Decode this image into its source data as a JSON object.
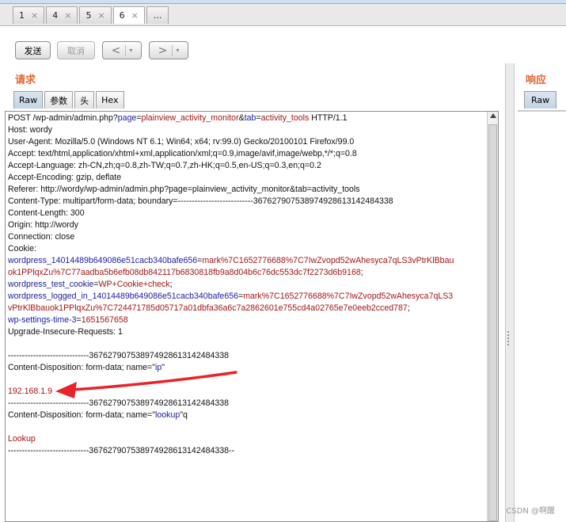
{
  "tabs": [
    {
      "label": "1",
      "close": "×"
    },
    {
      "label": "4",
      "close": "×"
    },
    {
      "label": "5",
      "close": "×"
    },
    {
      "label": "6",
      "close": "×"
    }
  ],
  "tabs_more": "...",
  "toolbar": {
    "send": "发送",
    "cancel": "取消",
    "back": "<",
    "forward": ">",
    "dropdown": "▾"
  },
  "request": {
    "heading": "请求",
    "tabs": [
      "Raw",
      "参数",
      "头",
      "Hex"
    ],
    "lines": [
      [
        {
          "t": "POST /wp-admin/admin.php?",
          "c": "blk"
        },
        {
          "t": "page",
          "c": "blu"
        },
        {
          "t": "=",
          "c": "blk"
        },
        {
          "t": "plainview_activity_monitor",
          "c": "red"
        },
        {
          "t": "&",
          "c": "blk"
        },
        {
          "t": "tab",
          "c": "blu"
        },
        {
          "t": "=",
          "c": "blk"
        },
        {
          "t": "activity_tools",
          "c": "red"
        },
        {
          "t": " HTTP/1.1",
          "c": "blk"
        }
      ],
      [
        {
          "t": "Host: wordy",
          "c": "blk"
        }
      ],
      [
        {
          "t": "User-Agent: Mozilla/5.0 (Windows NT 6.1; Win64; x64; rv:99.0) Gecko/20100101 Firefox/99.0",
          "c": "blk"
        }
      ],
      [
        {
          "t": "Accept: text/html,application/xhtml+xml,application/xml;q=0.9,image/avif,image/webp,*/*;q=0.8",
          "c": "blk"
        }
      ],
      [
        {
          "t": "Accept-Language: zh-CN,zh;q=0.8,zh-TW;q=0.7,zh-HK;q=0.5,en-US;q=0.3,en;q=0.2",
          "c": "blk"
        }
      ],
      [
        {
          "t": "Accept-Encoding: gzip, deflate",
          "c": "blk"
        }
      ],
      [
        {
          "t": "Referer: http://wordy/wp-admin/admin.php?page=plainview_activity_monitor&tab=activity_tools",
          "c": "blk"
        }
      ],
      [
        {
          "t": "Content-Type: multipart/form-data; boundary=---------------------------367627907538974928613142484338",
          "c": "blk"
        }
      ],
      [
        {
          "t": "Content-Length: 300",
          "c": "blk"
        }
      ],
      [
        {
          "t": "Origin: http://wordy",
          "c": "blk"
        }
      ],
      [
        {
          "t": "Connection: close",
          "c": "blk"
        }
      ],
      [
        {
          "t": "Cookie:",
          "c": "blk"
        }
      ],
      [
        {
          "t": "wordpress_14014489b649086e51cacb340bafe656",
          "c": "blu"
        },
        {
          "t": "=",
          "c": "blk"
        },
        {
          "t": "mark%7C1652776688%7C7IwZvopd52wAhesyca7qLS3vPtrKlBbau",
          "c": "red"
        }
      ],
      [
        {
          "t": "ok1PPlqxZu%7C77aadba5b6efb08db842117b6830818fb9a8d04b6c76dc553dc7f2273d6b9168",
          "c": "red"
        },
        {
          "t": ";",
          "c": "blk"
        }
      ],
      [
        {
          "t": "wordpress_test_cookie",
          "c": "blu"
        },
        {
          "t": "=",
          "c": "blk"
        },
        {
          "t": "WP+Cookie+check",
          "c": "red"
        },
        {
          "t": ";",
          "c": "blk"
        }
      ],
      [
        {
          "t": "wordpress_logged_in_14014489b649086e51cacb340bafe656",
          "c": "blu"
        },
        {
          "t": "=",
          "c": "blk"
        },
        {
          "t": "mark%7C1652776688%7C7IwZvopd52wAhesyca7qLS3",
          "c": "red"
        }
      ],
      [
        {
          "t": "vPtrKlBbauok1PPlqxZu%7C724471785d05717a01dbfa36a6c7a2862601e755cd4a02765e7e0eeb2cced787",
          "c": "red"
        },
        {
          "t": ";",
          "c": "blk"
        }
      ],
      [
        {
          "t": "wp-settings-time-3",
          "c": "blu"
        },
        {
          "t": "=",
          "c": "blk"
        },
        {
          "t": "1651567658",
          "c": "red"
        }
      ],
      [
        {
          "t": "Upgrade-Insecure-Requests: 1",
          "c": "blk"
        }
      ],
      [
        {
          "t": "",
          "c": "blk"
        }
      ],
      [
        {
          "t": "-----------------------------367627907538974928613142484338",
          "c": "blk"
        }
      ],
      [
        {
          "t": "Content-Disposition: form-data; name=\"",
          "c": "blk"
        },
        {
          "t": "ip",
          "c": "blu"
        },
        {
          "t": "\"",
          "c": "blk"
        }
      ],
      [
        {
          "t": "",
          "c": "blk"
        }
      ],
      [
        {
          "t": "192.168.1.9",
          "c": "red"
        }
      ],
      [
        {
          "t": "-----------------------------367627907538974928613142484338",
          "c": "blk"
        }
      ],
      [
        {
          "t": "Content-Disposition: form-data; name=\"",
          "c": "blk"
        },
        {
          "t": "lookup",
          "c": "blu"
        },
        {
          "t": "\"q",
          "c": "blk"
        }
      ],
      [
        {
          "t": "",
          "c": "blk"
        }
      ],
      [
        {
          "t": "Lookup",
          "c": "red"
        }
      ],
      [
        {
          "t": "-----------------------------367627907538974928613142484338--",
          "c": "blk"
        }
      ]
    ]
  },
  "response": {
    "heading": "响应",
    "tab": "Raw"
  },
  "watermark": "CSDN @啊醒",
  "colors": {
    "heading": "#e2652b",
    "param_name": "#1a1aa6",
    "param_value": "#a31515",
    "annotation_arrow": "#e8232a"
  }
}
